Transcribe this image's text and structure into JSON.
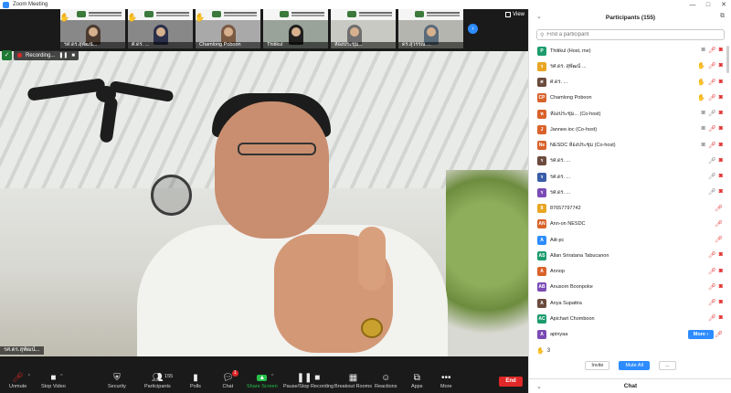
{
  "window": {
    "title": "Zoom Meeting",
    "controls": [
      "—",
      "□",
      "✕"
    ]
  },
  "view": {
    "label": "View"
  },
  "thumbnails": [
    {
      "name": "รศ.ดร.สุพัฒน์...",
      "hand": true
    },
    {
      "name": "ศ.ดร. ...",
      "hand": true
    },
    {
      "name": "Chamlong Poboon",
      "hand": true
    },
    {
      "name": "Thitikul",
      "hand": false
    },
    {
      "name": "ห้องประชุม...",
      "hand": false
    },
    {
      "name": "ดร.สุวรรณ ...",
      "hand": false
    }
  ],
  "recording": {
    "label": "Recording..."
  },
  "speaker": {
    "name": "รศ.ดร.สุพัฒน์..."
  },
  "toolbar": {
    "unmute": "Unmute",
    "stop_video": "Stop Video",
    "security": "Security",
    "participants": "Participants",
    "participants_count": "155",
    "polls": "Polls",
    "chat": "Chat",
    "chat_badge": "1",
    "share_screen": "Share Screen",
    "pause_record": "Pause/Stop Recording",
    "breakout": "Breakout Rooms",
    "reactions": "Reactions",
    "apps": "Apps",
    "more": "More",
    "end": "End"
  },
  "panel": {
    "title": "Participants (155)",
    "search_placeholder": "Find a participant",
    "participants": [
      {
        "initials": "P",
        "color": "#1c9c6d",
        "name": "Thitikul (Host, me)",
        "icons": [
          "cam",
          "mute",
          "camoff"
        ]
      },
      {
        "initials": "ร",
        "color": "#e8a623",
        "name": "รศ.ดร. สุพัฒน์ ...",
        "icons": [
          "hand",
          "mute",
          "camoff"
        ]
      },
      {
        "initials": "ศ",
        "color": "#6b4b3e",
        "name": "ศ.ดร. ...",
        "icons": [
          "hand",
          "mute",
          "camoff"
        ]
      },
      {
        "initials": "CP",
        "color": "#d9622b",
        "name": "Chamlong Poboon",
        "icons": [
          "hand",
          "mute",
          "camoff"
        ]
      },
      {
        "initials": "ห",
        "color": "#d9622b",
        "name": "ห้องประชุม... (Co-host)",
        "icons": [
          "cam",
          "mic",
          "camoff"
        ]
      },
      {
        "initials": "J",
        "color": "#d9622b",
        "name": "Jannee.ioc (Co-host)",
        "icons": [
          "cam",
          "mute",
          "camoff"
        ]
      },
      {
        "initials": "Ne",
        "color": "#d9622b",
        "name": "NESDC ห้องประชุม (Co-host)",
        "icons": [
          "cam",
          "mute",
          "camoff"
        ]
      },
      {
        "initials": "ร",
        "color": "#6b4b3e",
        "name": "รศ.ดร. ...",
        "icons": [
          "mic",
          "camoff"
        ]
      },
      {
        "initials": "ร",
        "color": "#3a5da8",
        "name": "รศ.ดร. ...",
        "icons": [
          "mic",
          "camoff"
        ]
      },
      {
        "initials": "ร",
        "color": "#7b4bb5",
        "name": "รศ.ดร. ...",
        "icons": [
          "mic",
          "camoff"
        ]
      },
      {
        "initials": "8",
        "color": "#e8a623",
        "name": "87657797742",
        "icons": [
          "mute"
        ]
      },
      {
        "initials": "AN",
        "color": "#d9622b",
        "name": "Ann-on NESDC",
        "icons": [
          "mute"
        ]
      },
      {
        "initials": "A",
        "color": "#2d8cff",
        "name": "Aiit-pc",
        "icons": [
          "mute"
        ]
      },
      {
        "initials": "AS",
        "color": "#1c9c6d",
        "name": "Allan Sriratana Tabucanon",
        "icons": [
          "mute",
          "camoff"
        ]
      },
      {
        "initials": "A",
        "color": "#d9622b",
        "name": "Annop",
        "icons": [
          "mute",
          "camoff"
        ]
      },
      {
        "initials": "AB",
        "color": "#7b4bb5",
        "name": "Anusorn Boonpoke",
        "icons": [
          "mute",
          "camoff"
        ]
      },
      {
        "initials": "A",
        "color": "#6b4b3e",
        "name": "Anya Supattra",
        "icons": [
          "mute",
          "camoff"
        ]
      },
      {
        "initials": "AC",
        "color": "#1c9c6d",
        "name": "Apichart Chomboon",
        "icons": [
          "mute",
          "camoff"
        ]
      },
      {
        "initials": "A",
        "color": "#7b4bb5",
        "name": "apinyaa",
        "icons": [
          "more",
          "mute"
        ]
      }
    ],
    "more_label": "More ›",
    "raised_count": "3",
    "invite": "Invite",
    "mute_all": "Mute All",
    "overflow": "...",
    "chat_title": "Chat"
  }
}
